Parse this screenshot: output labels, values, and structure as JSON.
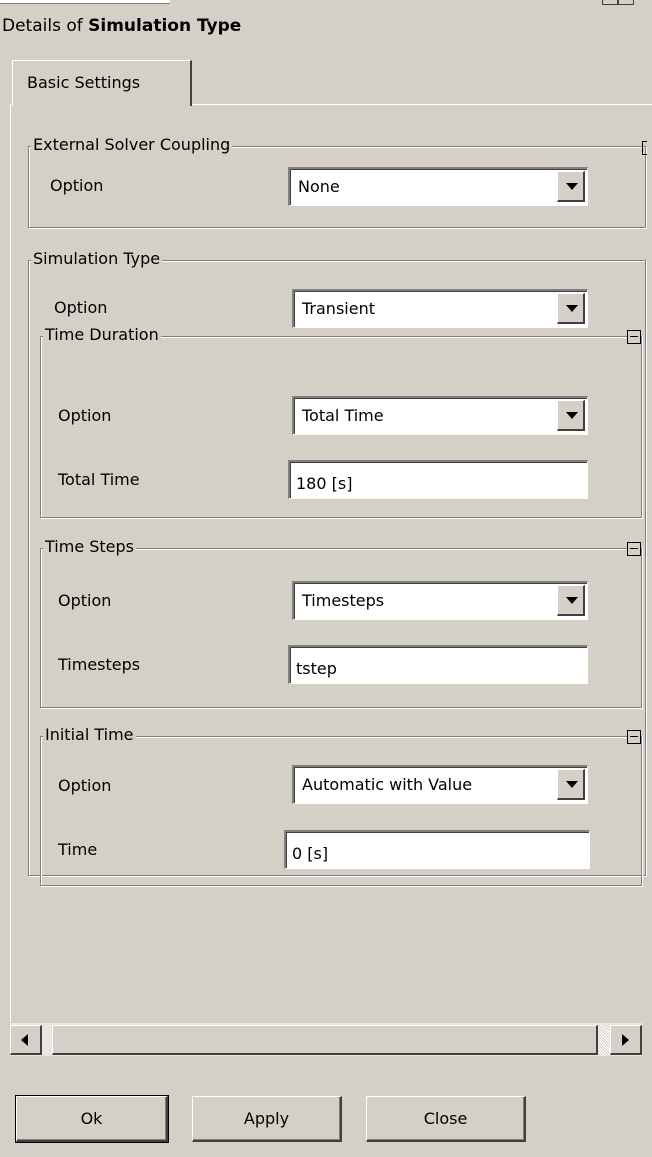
{
  "header": {
    "prefix": "Details of",
    "title": "Simulation Type"
  },
  "tabs": [
    {
      "label": "Basic Settings",
      "active": true
    }
  ],
  "groups": {
    "external_solver_coupling": {
      "title": "External Solver Coupling",
      "option_label": "Option",
      "option_value": "None"
    },
    "simulation_type": {
      "title": "Simulation Type",
      "option_label": "Option",
      "option_value": "Transient",
      "time_duration": {
        "title": "Time Duration",
        "option_label": "Option",
        "option_value": "Total Time",
        "total_time_label": "Total Time",
        "total_time_value": "180 [s]"
      },
      "time_steps": {
        "title": "Time Steps",
        "option_label": "Option",
        "option_value": "Timesteps",
        "timesteps_label": "Timesteps",
        "timesteps_value": "tstep"
      },
      "initial_time": {
        "title": "Initial Time",
        "option_label": "Option",
        "option_value": "Automatic with Value",
        "time_label": "Time",
        "time_value": "0 [s]"
      }
    }
  },
  "buttons": {
    "ok": "Ok",
    "apply": "Apply",
    "close": "Close"
  },
  "icons": {
    "collapse": "collapse-minus-icon",
    "dropdown": "chevron-down-icon",
    "scroll_left": "arrow-left-icon",
    "scroll_right": "arrow-right-icon"
  }
}
